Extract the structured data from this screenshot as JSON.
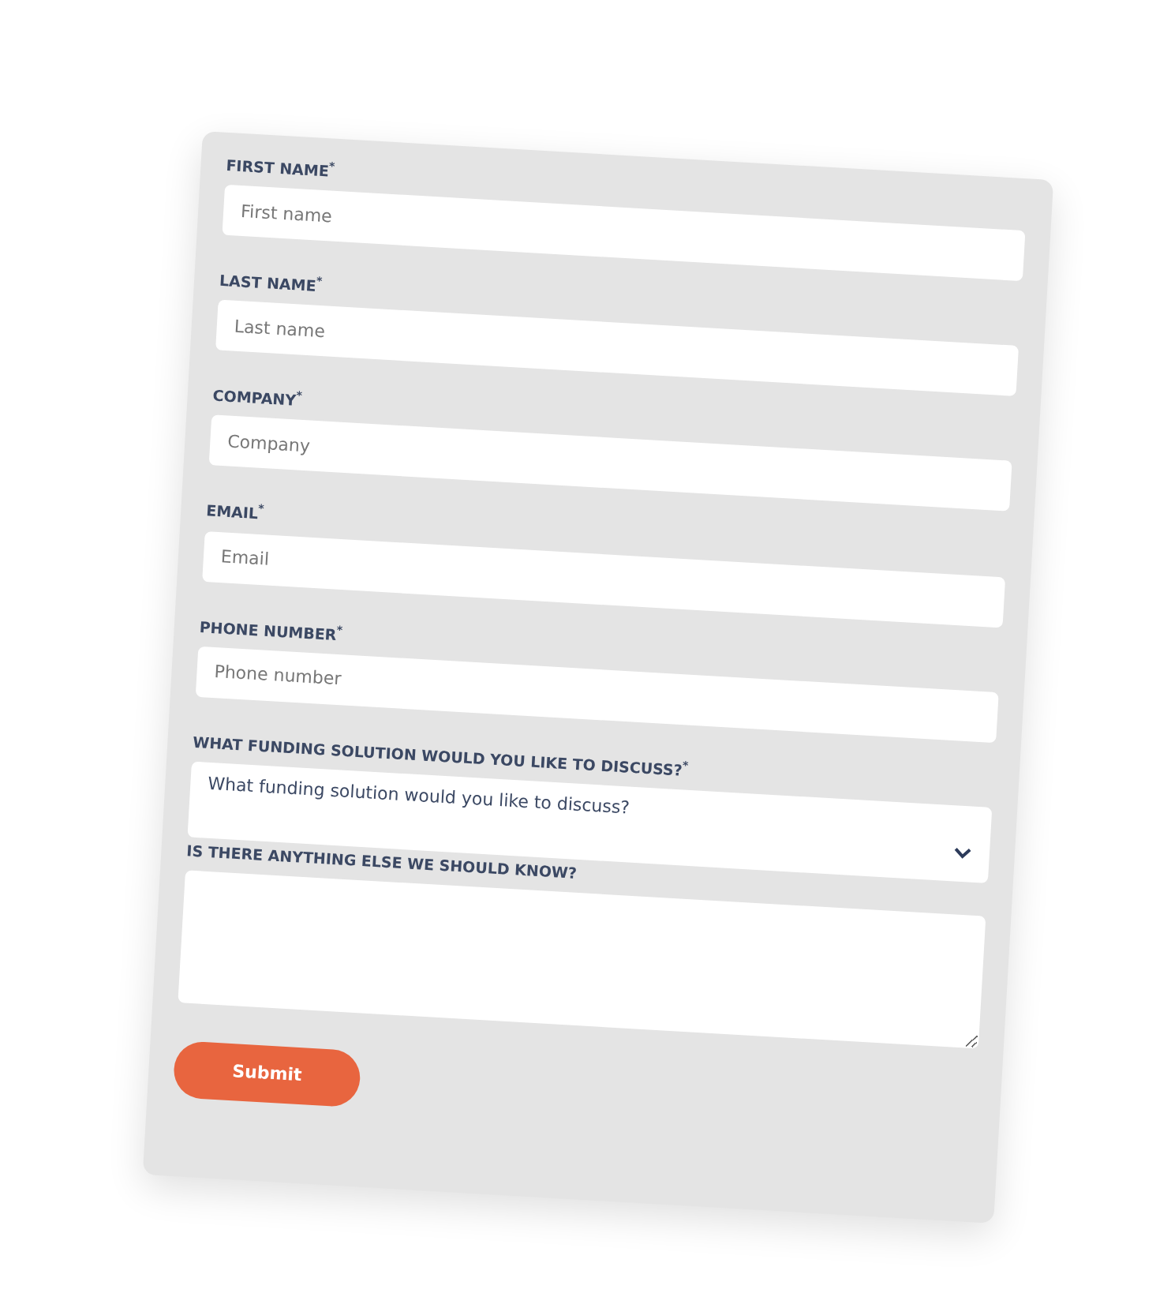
{
  "form": {
    "fields": [
      {
        "kind": "text",
        "label": "FIRST NAME$^{*}$",
        "placeholder": "First name"
      },
      {
        "kind": "text",
        "label": "LAST NAME$^{*}$",
        "placeholder": "Last name"
      },
      {
        "kind": "text",
        "label": "COMPANY$^{*}$",
        "placeholder": "Company"
      },
      {
        "kind": "text",
        "label": "EMAIL$^{*}$",
        "placeholder": "Email"
      },
      {
        "kind": "text",
        "label": "PHONE NUMBER$^{*}$",
        "placeholder": "Phone number"
      },
      {
        "kind": "select",
        "label": "WHAT FUNDING SOLUTION WOULD YOU LIKE TO DISCUSS?$^{*}$",
        "value": "What funding solution would you like to discuss?"
      },
      {
        "kind": "textarea",
        "label": "IS THERE ANYTHING ELSE WE SHOULD KNOW?"
      }
    ],
    "submit": "Submit"
  }
}
